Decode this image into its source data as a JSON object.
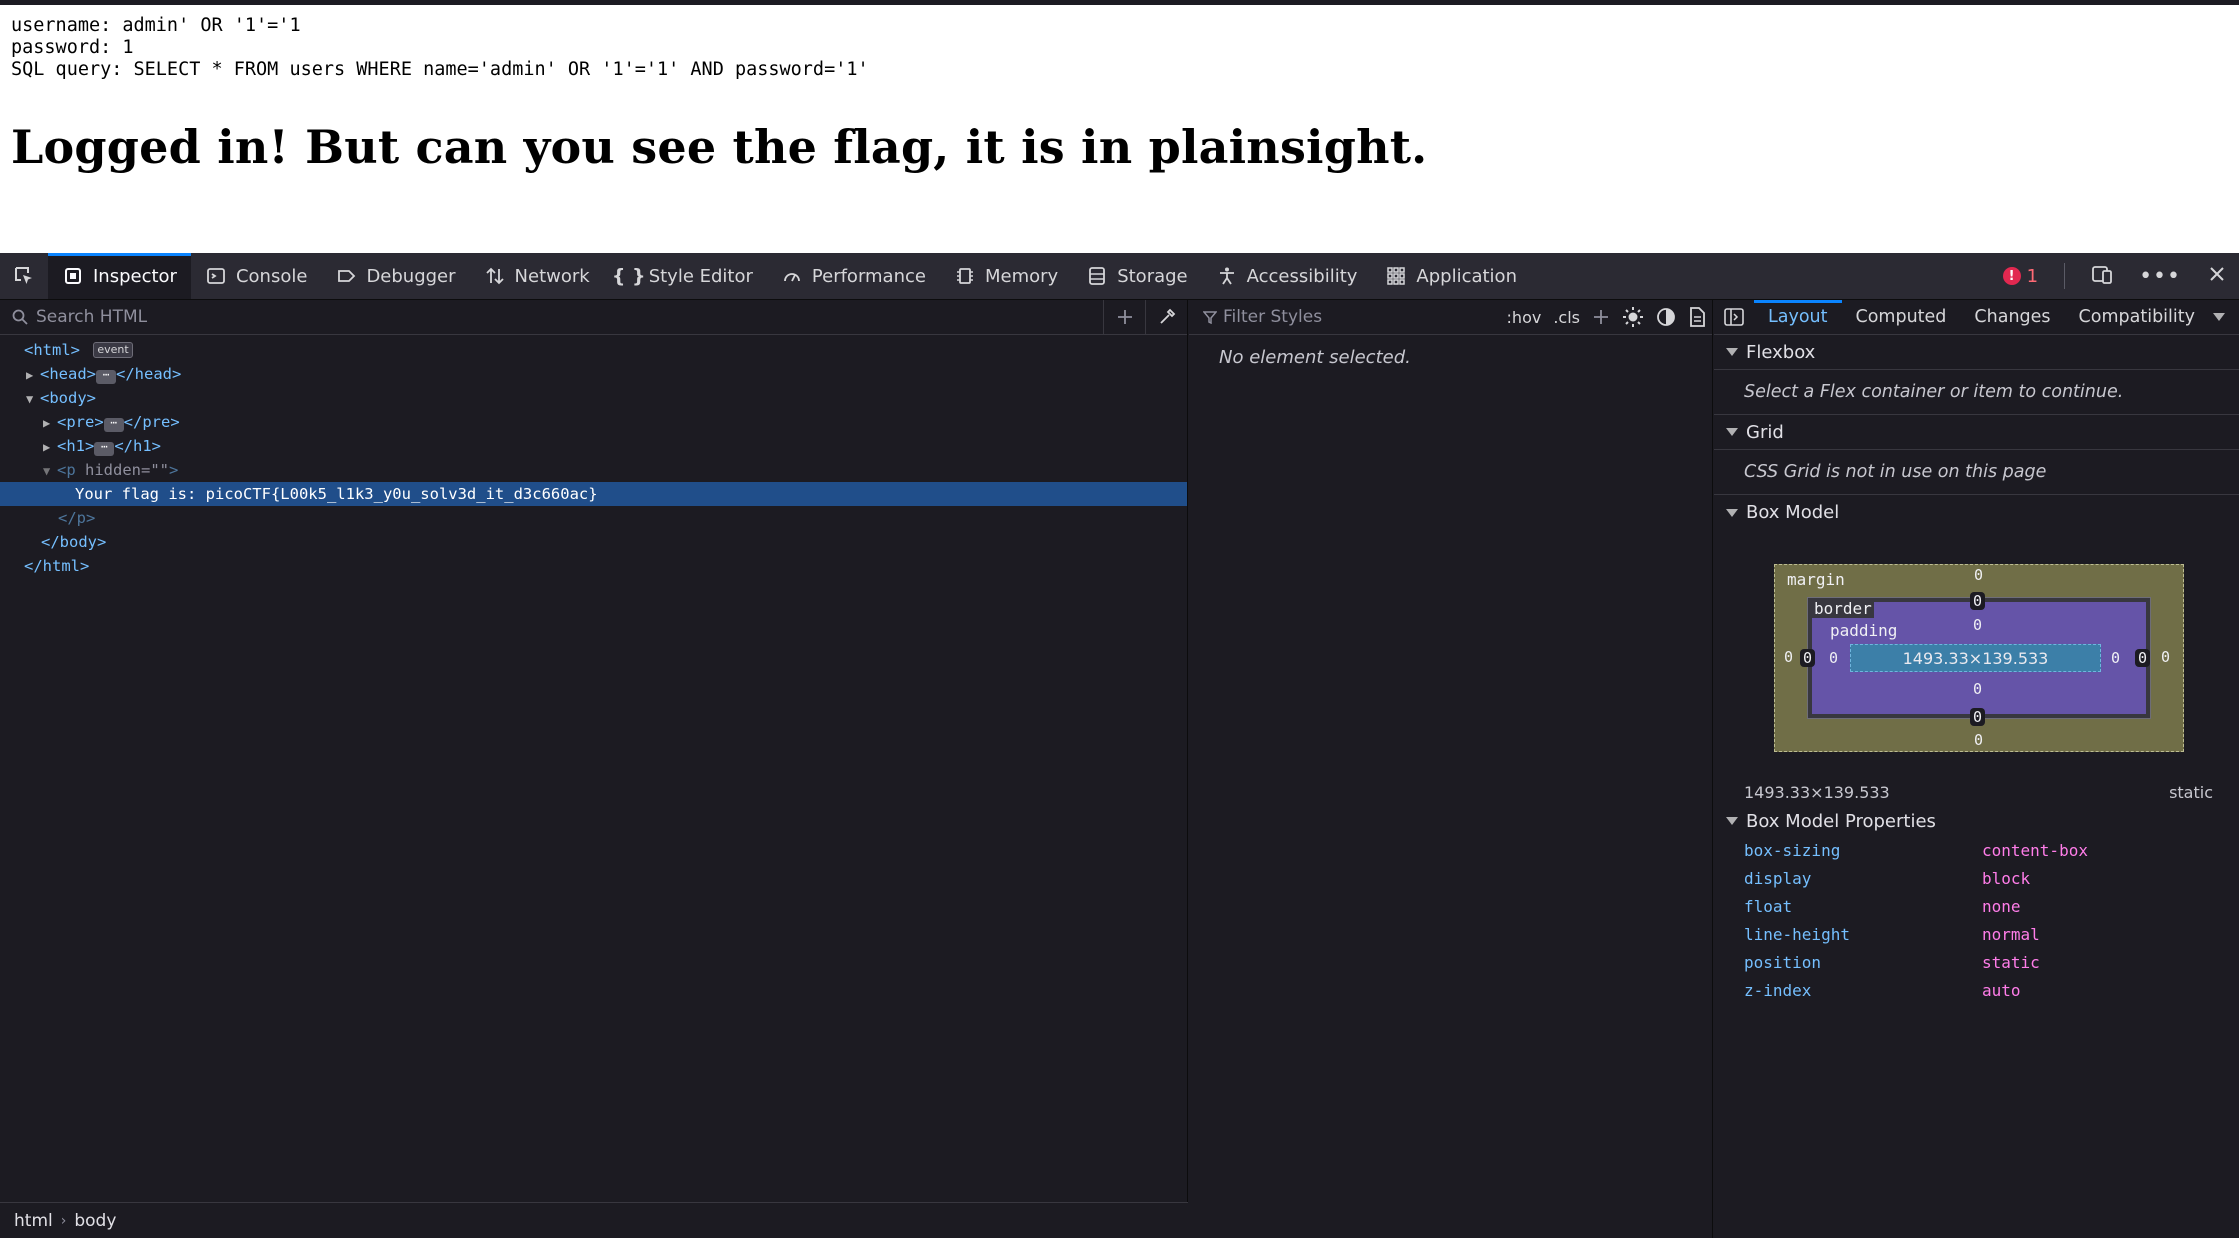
{
  "page": {
    "pre_lines": [
      "username: admin' OR '1'='1",
      "password: 1",
      "SQL query: SELECT * FROM users WHERE name='admin' OR '1'='1' AND password='1'"
    ],
    "heading": "Logged in! But can you see the flag, it is in plainsight."
  },
  "toolbar": {
    "tabs": [
      {
        "label": "Inspector",
        "icon": "inspector-icon",
        "active": true
      },
      {
        "label": "Console",
        "icon": "console-icon"
      },
      {
        "label": "Debugger",
        "icon": "debugger-icon"
      },
      {
        "label": "Network",
        "icon": "network-icon"
      },
      {
        "label": "Style Editor",
        "icon": "style-editor-icon"
      },
      {
        "label": "Performance",
        "icon": "performance-icon"
      },
      {
        "label": "Memory",
        "icon": "memory-icon"
      },
      {
        "label": "Storage",
        "icon": "storage-icon"
      },
      {
        "label": "Accessibility",
        "icon": "accessibility-icon"
      },
      {
        "label": "Application",
        "icon": "application-icon"
      }
    ],
    "error_count": "1"
  },
  "markup": {
    "search_placeholder": "Search HTML",
    "tree": {
      "html_open": "<html>",
      "event_badge": "event",
      "head_open": "<head>",
      "head_close": "</head>",
      "body_open": "<body>",
      "pre_open": "<pre>",
      "pre_close": "</pre>",
      "h1_open": "<h1>",
      "h1_close": "</h1>",
      "p_open_tag": "<p",
      "p_attr": " hidden=\"\"",
      "p_open_end": ">",
      "flag_text": "Your flag is: picoCTF{L00k5_l1k3_y0u_solv3d_it_d3c660ac}",
      "p_close": "</p>",
      "body_close": "</body>",
      "html_close": "</html>",
      "ellipsis": "⋯"
    },
    "breadcrumbs": [
      "html",
      "body"
    ]
  },
  "rules": {
    "filter_placeholder": "Filter Styles",
    "hov": ":hov",
    "cls": ".cls",
    "empty_message": "No element selected."
  },
  "sidebar": {
    "tabs": [
      {
        "label": "Layout",
        "active": true
      },
      {
        "label": "Computed"
      },
      {
        "label": "Changes"
      },
      {
        "label": "Compatibility"
      }
    ],
    "flexbox": {
      "title": "Flexbox",
      "message": "Select a Flex container or item to continue."
    },
    "grid": {
      "title": "Grid",
      "message": "CSS Grid is not in use on this page"
    },
    "box_model": {
      "title": "Box Model",
      "margin_label": "margin",
      "border_label": "border",
      "padding_label": "padding",
      "content_size": "1493.33×139.533",
      "margin_top": "0",
      "margin_right": "0",
      "margin_bottom": "0",
      "margin_left": "0",
      "border_top": "0",
      "border_right": "0",
      "border_bottom": "0",
      "border_left": "0",
      "padding_top": "0",
      "padding_right": "0",
      "padding_bottom": "0",
      "padding_left": "0",
      "summary_size": "1493.33×139.533",
      "summary_position": "static"
    },
    "box_model_properties": {
      "title": "Box Model Properties",
      "rows": [
        {
          "name": "box-sizing",
          "value": "content-box"
        },
        {
          "name": "display",
          "value": "block"
        },
        {
          "name": "float",
          "value": "none"
        },
        {
          "name": "line-height",
          "value": "normal"
        },
        {
          "name": "position",
          "value": "static"
        },
        {
          "name": "z-index",
          "value": "auto"
        }
      ]
    }
  }
}
